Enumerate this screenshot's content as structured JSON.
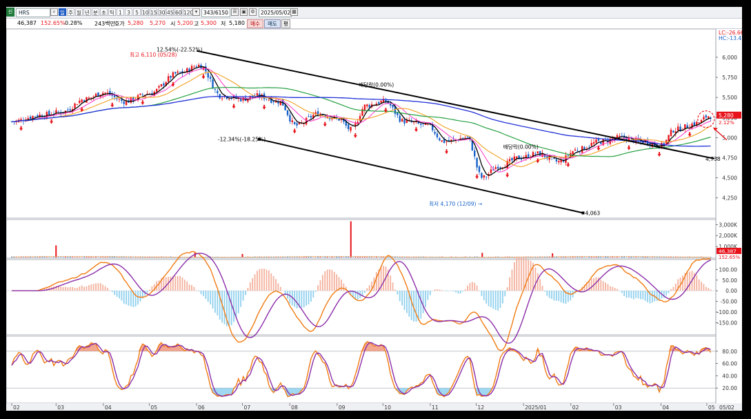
{
  "toolbar": {
    "market_badge": "신",
    "stock_name": "HRS",
    "periods": [
      "일",
      "주",
      "월",
      "년",
      "분",
      "초",
      "틱"
    ],
    "selected_period": "일",
    "intervals": [
      "1",
      "3",
      "5",
      "10",
      "15",
      "30",
      "45",
      "60",
      "120"
    ],
    "bar_count": "343",
    "bar_total": "/6150",
    "date": "2025/05/02"
  },
  "quote": {
    "volume": "46,387",
    "volume_ratio": "152.65%",
    "turnover": "0.28%",
    "amount": "243백만",
    "ask_label": "호가",
    "ask_value": "5,280",
    "price": "5,270",
    "open_label": "시",
    "open": "5,200",
    "high_label": "고",
    "high": "5,300",
    "low_label": "저",
    "low": "5,180",
    "buy_label": "매수",
    "sell_label": "매도",
    "extra_label": "평"
  },
  "colors": {
    "up": "#e8131a",
    "down": "#1560c8",
    "ma5": "#000000",
    "ma10": "#ff44cc",
    "ma20": "#f0a020",
    "ma60": "#24a040",
    "ma120": "#2030d8",
    "osc_orange": "#f07a10",
    "osc_purple": "#8a2ca8",
    "hist_up": "#f4b09c",
    "hist_down": "#8fd0ee"
  },
  "chart_data": {
    "type": "line",
    "panels": {
      "price": {
        "type": "candlestick",
        "ylim": [
          4050,
          6300
        ],
        "ticks": [
          "6,000",
          "5,750",
          "5,500",
          "5,250",
          "5,000",
          "4,750",
          "4,500",
          "4,250"
        ],
        "tick_values": [
          6000,
          5750,
          5500,
          5250,
          5000,
          4750,
          4500,
          4250
        ],
        "corner_labels": [
          "LC:-26.66",
          "HC:-13.42"
        ],
        "current_price": "5,280",
        "current_pct": "2.12%",
        "close_path": [
          {
            "date": "2024-02-01",
            "close": 5200
          },
          {
            "date": "2024-02-20",
            "close": 5280
          },
          {
            "date": "2024-03-05",
            "close": 5320
          },
          {
            "date": "2024-03-20",
            "close": 5480
          },
          {
            "date": "2024-04-01",
            "close": 5560
          },
          {
            "date": "2024-04-15",
            "close": 5450
          },
          {
            "date": "2024-05-01",
            "close": 5550
          },
          {
            "date": "2024-05-20",
            "close": 5800
          },
          {
            "date": "2024-06-03",
            "close": 5900
          },
          {
            "date": "2024-06-17",
            "close": 5520
          },
          {
            "date": "2024-07-01",
            "close": 5480
          },
          {
            "date": "2024-07-10",
            "close": 5520
          },
          {
            "date": "2024-07-25",
            "close": 5450
          },
          {
            "date": "2024-08-05",
            "close": 5150
          },
          {
            "date": "2024-08-20",
            "close": 5300
          },
          {
            "date": "2024-09-02",
            "close": 5230
          },
          {
            "date": "2024-09-10",
            "close": 5100
          },
          {
            "date": "2024-09-20",
            "close": 5400
          },
          {
            "date": "2024-10-02",
            "close": 5450
          },
          {
            "date": "2024-10-15",
            "close": 5200
          },
          {
            "date": "2024-10-30",
            "close": 5150
          },
          {
            "date": "2024-11-10",
            "close": 4950
          },
          {
            "date": "2024-11-25",
            "close": 5000
          },
          {
            "date": "2024-12-05",
            "close": 4500
          },
          {
            "date": "2024-12-16",
            "close": 4650
          },
          {
            "date": "2024-12-30",
            "close": 4750
          },
          {
            "date": "2025-01-10",
            "close": 4800
          },
          {
            "date": "2025-01-24",
            "close": 4700
          },
          {
            "date": "2025-02-05",
            "close": 4850
          },
          {
            "date": "2025-02-20",
            "close": 4950
          },
          {
            "date": "2025-03-05",
            "close": 5000
          },
          {
            "date": "2025-03-20",
            "close": 4950
          },
          {
            "date": "2025-04-01",
            "close": 4900
          },
          {
            "date": "2025-04-10",
            "close": 5100
          },
          {
            "date": "2025-04-25",
            "close": 5180
          },
          {
            "date": "2025-05-02",
            "close": 5270
          }
        ],
        "annotations": [
          {
            "text": "최고 6,110 (05/28)",
            "date": "2024-05-28",
            "value": 6110
          },
          {
            "text": "최저 4,170 (12/09) →",
            "date": "2024-12-09",
            "value": 4170
          },
          {
            "text": "12.54%(-22.52%)",
            "value": 6060
          },
          {
            "text": "-12.34%(-18.25%)",
            "value": 4980
          },
          {
            "text": "배당락(0.00%)",
            "date": "2024-09-26",
            "value": 5650
          },
          {
            "text": "배당락(0.00%)",
            "date": "2024-12-26",
            "value": 4880
          },
          {
            "text": "4,738",
            "value": 4738
          },
          {
            "text": "4,063",
            "value": 4063
          }
        ],
        "trend_upper": [
          {
            "date": "2024-06-01",
            "value": 6080
          },
          {
            "date": "2025-05-06",
            "value": 4738
          }
        ],
        "trend_lower": [
          {
            "date": "2024-07-12",
            "value": 4980
          },
          {
            "date": "2025-02-09",
            "value": 4063
          }
        ]
      },
      "volume": {
        "type": "bar",
        "ylim": [
          0,
          3400
        ],
        "ticks": [
          "3,000K",
          "2,000K",
          "1,000K"
        ],
        "tick_values": [
          3000,
          2000,
          1000
        ],
        "current_volume": "46,387",
        "current_ratio": "152.65%",
        "spikes": [
          {
            "date": "2024-03-01",
            "value": 1100
          },
          {
            "date": "2024-05-31",
            "value": 460
          },
          {
            "date": "2024-07-01",
            "value": 320
          },
          {
            "date": "2024-09-10",
            "value": 3300
          },
          {
            "date": "2024-12-05",
            "value": 420
          },
          {
            "date": "2025-01-20",
            "value": 380
          }
        ]
      },
      "macd": {
        "type": "line",
        "ylim": [
          -200,
          140
        ],
        "ticks": [
          "100.00",
          "50.00",
          "0.00",
          "-50.00",
          "-100.00",
          "-150.00"
        ],
        "tick_values": [
          100,
          50,
          0,
          -50,
          -100,
          -150
        ]
      },
      "stochastic": {
        "type": "line",
        "ylim": [
          0,
          100
        ],
        "ticks": [
          "80.00",
          "60.00",
          "40.00",
          "20.00"
        ],
        "tick_values": [
          80,
          60,
          40,
          20
        ]
      }
    },
    "x_ticks": [
      "02",
      "03",
      "04",
      "05",
      "06",
      "07",
      "08",
      "09",
      "10",
      "11",
      "12",
      "2025/01",
      "02",
      "03",
      "04",
      "05",
      "05/02"
    ]
  }
}
